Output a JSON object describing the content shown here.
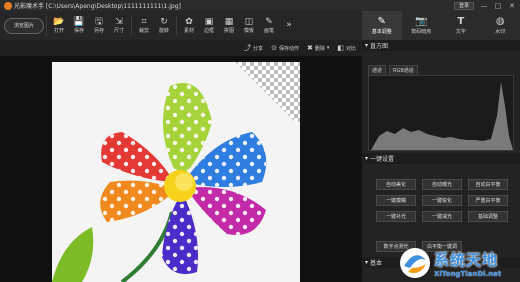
{
  "window": {
    "title": "光影魔术手 [C:\\Users\\Apeng\\Desktop\\1111111111\\1.jpg]",
    "login": "登录",
    "controls": [
      "—",
      "□",
      "✕"
    ]
  },
  "toolbar": {
    "browse": "浏览图片",
    "tools": [
      {
        "label": "打开",
        "icon": "open-icon"
      },
      {
        "label": "保存",
        "icon": "save-icon"
      },
      {
        "label": "另存",
        "icon": "save-as-icon"
      },
      {
        "label": "尺寸",
        "icon": "resize-icon"
      },
      {
        "label": "裁剪",
        "icon": "crop-icon"
      },
      {
        "label": "旋转",
        "icon": "rotate-icon"
      },
      {
        "label": "素材",
        "icon": "material-icon"
      },
      {
        "label": "边框",
        "icon": "border-icon"
      },
      {
        "label": "拼图",
        "icon": "collage-icon"
      },
      {
        "label": "模板",
        "icon": "template-icon"
      },
      {
        "label": "画笔",
        "icon": "brush-icon"
      }
    ],
    "more": "»"
  },
  "subbar": {
    "share": "分享",
    "save_action": "保存动作",
    "batch": "删除",
    "compare": "对比"
  },
  "right_panel": {
    "tabs": [
      {
        "label": "基本调整",
        "icon": "adjust-icon",
        "active": true
      },
      {
        "label": "数码暗房",
        "icon": "camera-icon",
        "active": false
      },
      {
        "label": "文字",
        "icon": "text-icon",
        "active": false
      },
      {
        "label": "水印",
        "icon": "watermark-icon",
        "active": false
      }
    ],
    "histogram": {
      "title": "直方图",
      "channels": [
        "通道",
        "RGB通道"
      ]
    },
    "one_click": {
      "title": "一键设置",
      "buttons": [
        "自动美化",
        "自动曝光",
        "自动白平衡",
        "一键模糊",
        "一键锐化",
        "严重白平衡",
        "一键补光",
        "一键减光",
        "基础调整"
      ],
      "wide_buttons": [
        "数字点测光",
        "白平衡一键调"
      ]
    },
    "basic": {
      "title": "基本"
    }
  },
  "watermark": {
    "cn": "系统天地",
    "en": "XiTongTianDi.net"
  },
  "colors": {
    "accent": "#3d8fe0",
    "panel_bg": "#232323",
    "toolbar_bg": "#262626"
  }
}
